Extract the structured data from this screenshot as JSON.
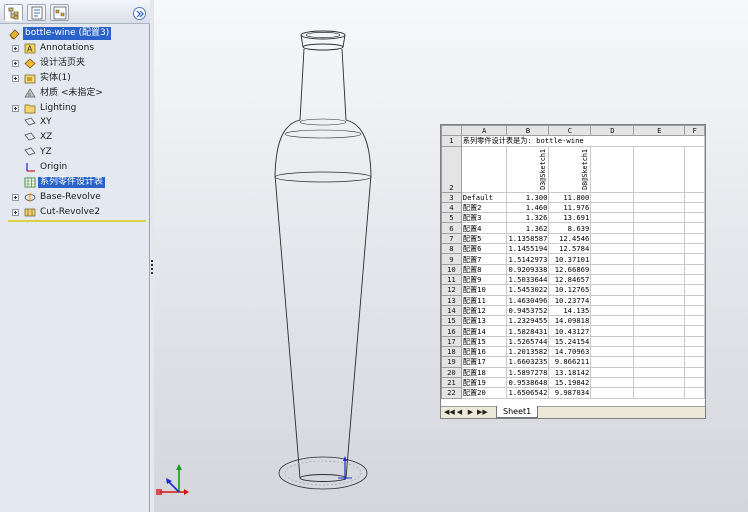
{
  "feature_tree": {
    "tabs": [
      {
        "name": "featuremanager-tab",
        "icon": "feature-tree-icon"
      },
      {
        "name": "propertymanager-tab",
        "icon": "property-sheet-icon"
      },
      {
        "name": "configurationmanager-tab",
        "icon": "configuration-icon"
      }
    ],
    "root_label": "bottle-wine (配置3)",
    "items": [
      {
        "label": "Annotations",
        "icon": "annotations-icon",
        "expandable": true
      },
      {
        "label": "设计活页夹",
        "icon": "design-binder-icon",
        "expandable": true
      },
      {
        "label": "实体(1)",
        "icon": "solid-bodies-icon",
        "expandable": true
      },
      {
        "label": "材质 <未指定>",
        "icon": "material-icon",
        "expandable": false
      },
      {
        "label": "Lighting",
        "icon": "lighting-folder-icon",
        "expandable": true
      },
      {
        "label": "XY",
        "icon": "plane-icon",
        "expandable": false
      },
      {
        "label": "XZ",
        "icon": "plane-icon",
        "expandable": false
      },
      {
        "label": "YZ",
        "icon": "plane-icon",
        "expandable": false
      },
      {
        "label": "Origin",
        "icon": "origin-icon",
        "expandable": false
      },
      {
        "label": "系列零件设计表",
        "icon": "design-table-icon",
        "expandable": false,
        "selected": true
      },
      {
        "label": "Base-Revolve",
        "icon": "revolve-feature-icon",
        "expandable": true
      },
      {
        "label": "Cut-Revolve2",
        "icon": "cut-revolve-icon",
        "expandable": true
      }
    ]
  },
  "design_table": {
    "columns": [
      "A",
      "B",
      "C",
      "D",
      "E",
      "F"
    ],
    "header_text": "系列零件设计表是为:  bottle-wine",
    "param_headers": [
      "D3@Sketch1",
      "D8@Sketch1"
    ],
    "rows": [
      {
        "num": "3",
        "name": "Default",
        "b": "1.300",
        "c": "11.800"
      },
      {
        "num": "4",
        "name": "配置2",
        "b": "1.460",
        "c": "11.976"
      },
      {
        "num": "5",
        "name": "配置3",
        "b": "1.326",
        "c": "13.691"
      },
      {
        "num": "6",
        "name": "配置4",
        "b": "1.362",
        "c": "8.639"
      },
      {
        "num": "7",
        "name": "配置5",
        "b": "1.1358587",
        "c": "12.4546"
      },
      {
        "num": "8",
        "name": "配置6",
        "b": "1.1455194",
        "c": "12.5784"
      },
      {
        "num": "9",
        "name": "配置7",
        "b": "1.5142973",
        "c": "10.37101"
      },
      {
        "num": "10",
        "name": "配置8",
        "b": "0.9209338",
        "c": "12.66869"
      },
      {
        "num": "11",
        "name": "配置9",
        "b": "1.5033644",
        "c": "12.84657"
      },
      {
        "num": "12",
        "name": "配置10",
        "b": "1.5453022",
        "c": "10.12765"
      },
      {
        "num": "13",
        "name": "配置11",
        "b": "1.4630496",
        "c": "10.23774"
      },
      {
        "num": "14",
        "name": "配置12",
        "b": "0.9453752",
        "c": "14.135"
      },
      {
        "num": "15",
        "name": "配置13",
        "b": "1.2329455",
        "c": "14.09818"
      },
      {
        "num": "16",
        "name": "配置14",
        "b": "1.5828431",
        "c": "10.43127"
      },
      {
        "num": "17",
        "name": "配置15",
        "b": "1.5265744",
        "c": "15.24154"
      },
      {
        "num": "18",
        "name": "配置16",
        "b": "1.2013582",
        "c": "14.70963"
      },
      {
        "num": "19",
        "name": "配置17",
        "b": "1.6603235",
        "c": "9.866211"
      },
      {
        "num": "20",
        "name": "配置18",
        "b": "1.5897278",
        "c": "13.18142"
      },
      {
        "num": "21",
        "name": "配置19",
        "b": "0.9538648",
        "c": "15.19842"
      },
      {
        "num": "22",
        "name": "配置20",
        "b": "1.6506542",
        "c": "9.987034"
      }
    ],
    "sheet_tab": "Sheet1",
    "nav_buttons": [
      "◀◀",
      "◀",
      "▶",
      "▶▶"
    ]
  },
  "colors": {
    "selection": "#2a62c9",
    "panel_bg": "#e4e9f1",
    "model_edges": "#2b2b2b",
    "triad_x": "#d01515",
    "triad_y": "#1a9a1a",
    "triad_z": "#1b2bd6"
  }
}
